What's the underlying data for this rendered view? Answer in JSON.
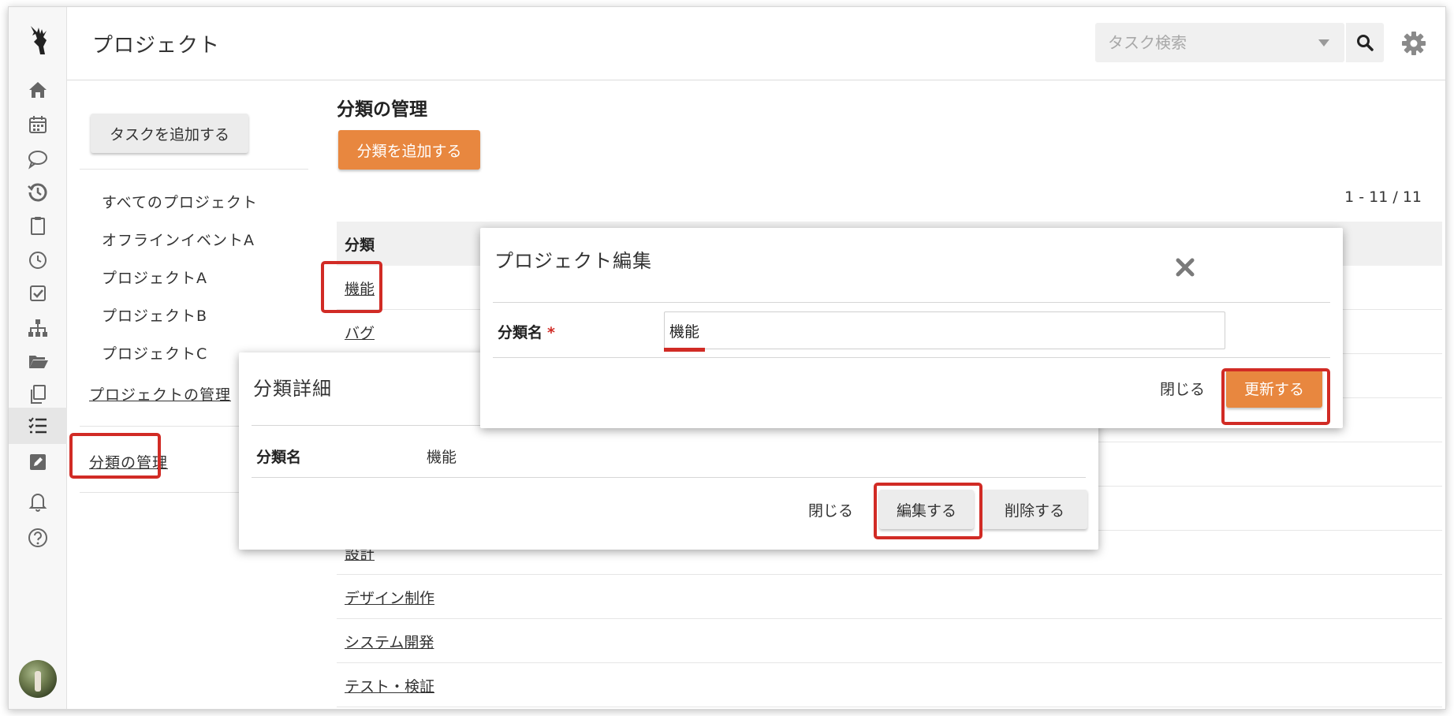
{
  "header": {
    "title": "プロジェクト",
    "search_placeholder": "タスク検索"
  },
  "sidebar": {
    "add_task_label": "タスクを追加する",
    "projects": [
      "すべてのプロジェクト",
      "オフラインイベントA",
      "プロジェクトA",
      "プロジェクトB",
      "プロジェクトC"
    ],
    "manage_projects_label": "プロジェクトの管理",
    "manage_categories_label": "分類の管理"
  },
  "main": {
    "title": "分類の管理",
    "add_category_label": "分類を追加する",
    "pagination": "1 - 11 / 11",
    "column_header": "分類",
    "rows": [
      "機能",
      "バグ",
      "設計",
      "デザイン制作",
      "システム開発",
      "テスト・検証"
    ]
  },
  "detail_modal": {
    "title": "分類詳細",
    "field_label": "分類名",
    "field_value": "機能",
    "close_label": "閉じる",
    "edit_label": "編集する",
    "delete_label": "削除する"
  },
  "edit_modal": {
    "title": "プロジェクト編集",
    "field_label": "分類名",
    "required_mark": "*",
    "field_value": "機能",
    "close_label": "閉じる",
    "update_label": "更新する"
  },
  "colors": {
    "accent": "#e8873f",
    "highlight": "#d12b25"
  }
}
